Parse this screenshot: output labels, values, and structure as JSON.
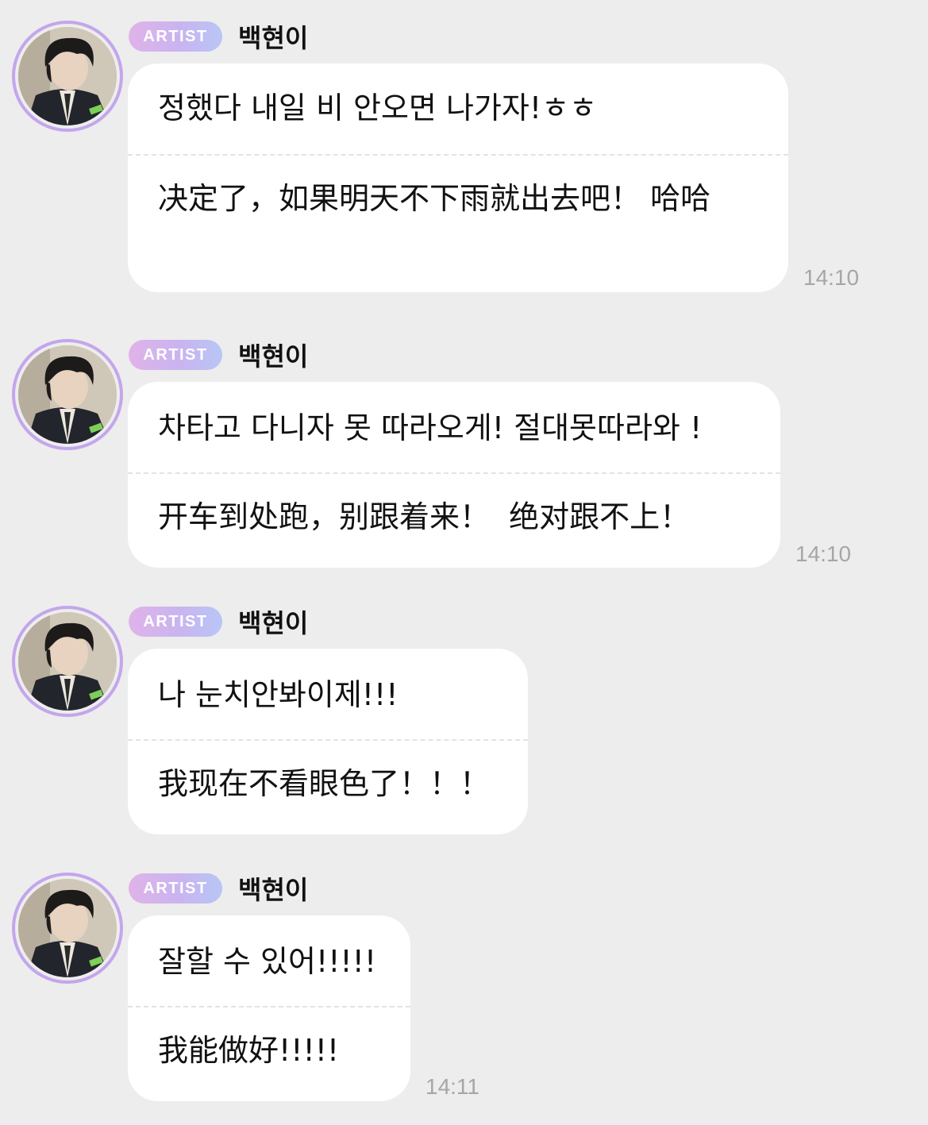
{
  "messages": [
    {
      "badge": "ARTIST",
      "name": "백현이",
      "korean": "정했다 내일 비 안오면 나가자!ㅎㅎ",
      "chinese": "决定了，如果明天不下雨就出去吧！ 哈哈",
      "time": "14:10"
    },
    {
      "badge": "ARTIST",
      "name": "백현이",
      "korean": "차타고 다니자 못 따라오게! 절대못따라와 !",
      "chinese": "开车到处跑，别跟着来！  绝对跟不上！",
      "time": "14:10"
    },
    {
      "badge": "ARTIST",
      "name": "백현이",
      "korean": "나 눈치안봐이제!!!",
      "chinese": "我现在不看眼色了！！！",
      "time": ""
    },
    {
      "badge": "ARTIST",
      "name": "백현이",
      "korean": "잘할 수 있어!!!!!",
      "chinese": "我能做好!!!!!",
      "time": "14:11"
    }
  ],
  "colors": {
    "background": "#ededed",
    "bubble": "#ffffff",
    "avatar_ring": "#c3a6ec",
    "badge_gradient_start": "#e0b3e8",
    "badge_gradient_end": "#b8c6f6",
    "timestamp": "#a6a6a6"
  },
  "icons": {
    "avatar": "profile-photo"
  }
}
